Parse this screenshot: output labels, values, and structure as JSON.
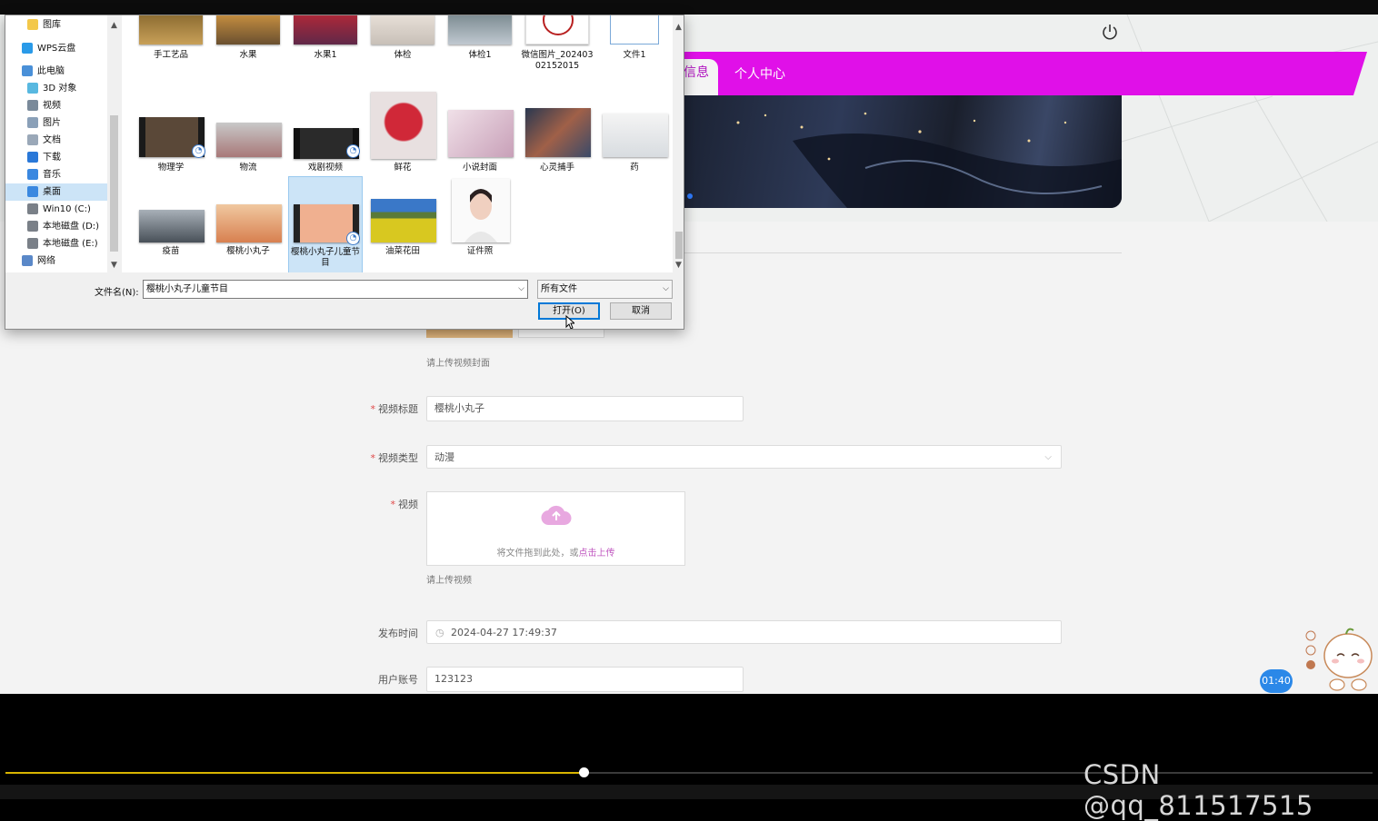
{
  "nav": {
    "active_partial": "信息",
    "item": "个人中心"
  },
  "form": {
    "cover_hint": "请上传视频封面",
    "title_label": "视频标题",
    "title_value": "樱桃小丸子",
    "type_label": "视频类型",
    "type_value": "动漫",
    "video_label": "视频",
    "upload_text": "将文件拖到此处，或",
    "upload_link": "点击上传",
    "video_hint": "请上传视频",
    "time_label": "发布时间",
    "time_value": "2024-04-27 17:49:37",
    "account_label": "用户账号",
    "account_value": "123123",
    "required_mark": "*"
  },
  "widget": {
    "time_badge": "01:40"
  },
  "player": {
    "progress_fraction": 0.423,
    "watermark": "CSDN @qq_811517515"
  },
  "dialog": {
    "nav_items": [
      {
        "label": "图库",
        "icon": "folder-icon"
      },
      {
        "label": "WPS云盘",
        "icon": "cloud-icon"
      },
      {
        "label": "此电脑",
        "icon": "computer-icon"
      },
      {
        "label": "3D 对象",
        "icon": "cube-icon"
      },
      {
        "label": "视频",
        "icon": "video-folder-icon"
      },
      {
        "label": "图片",
        "icon": "picture-folder-icon"
      },
      {
        "label": "文档",
        "icon": "document-folder-icon"
      },
      {
        "label": "下载",
        "icon": "download-icon"
      },
      {
        "label": "音乐",
        "icon": "music-icon"
      },
      {
        "label": "桌面",
        "icon": "desktop-icon"
      },
      {
        "label": "Win10 (C:)",
        "icon": "drive-icon"
      },
      {
        "label": "本地磁盘 (D:)",
        "icon": "drive-icon"
      },
      {
        "label": "本地磁盘 (E:)",
        "icon": "drive-icon"
      },
      {
        "label": "网络",
        "icon": "network-icon"
      }
    ],
    "files_row1": [
      "手工艺品",
      "水果",
      "水果1",
      "体检",
      "体检1",
      "微信图片_20240302152015",
      "文件1"
    ],
    "files_row2": [
      "物理学",
      "物流",
      "戏剧视频",
      "鲜花",
      "小说封面",
      "心灵捕手",
      "药"
    ],
    "files_row3": [
      "疫苗",
      "樱桃小丸子",
      "樱桃小丸子儿童节目",
      "油菜花田",
      "证件照"
    ],
    "filename_label": "文件名(N):",
    "filename_value": "樱桃小丸子儿童节目",
    "filetype_value": "所有文件",
    "open_button": "打开(O)",
    "cancel_button": "取消"
  },
  "colors": {
    "nav_magenta": "#e010e8",
    "link_pink": "#c058c0",
    "selection_blue": "#cce4f7",
    "progress_yellow": "#d8b400"
  }
}
